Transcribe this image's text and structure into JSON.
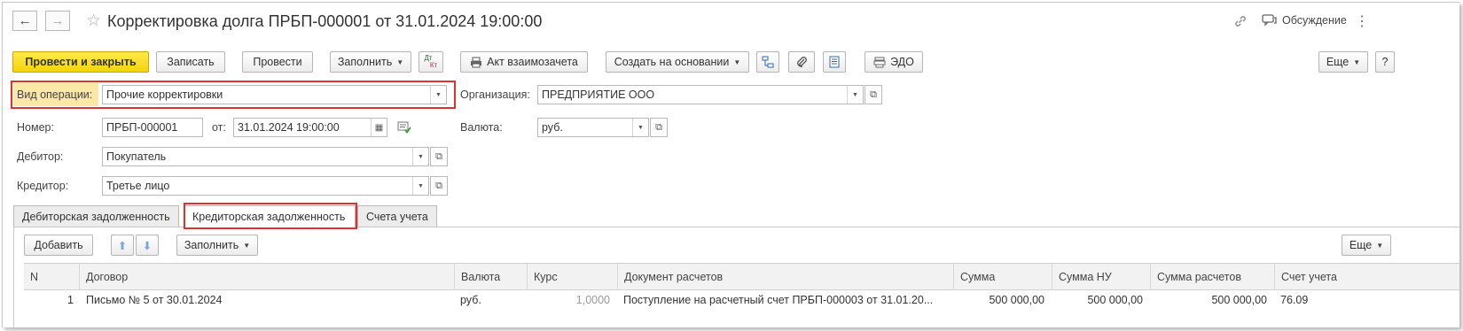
{
  "window": {
    "title": "Корректировка долга ПРБП-000001 от 31.01.2024 19:00:00",
    "discussion": "Обсуждение"
  },
  "toolbar": {
    "post_close": "Провести и закрыть",
    "save": "Записать",
    "post": "Провести",
    "fill": "Заполнить",
    "dtkt_top": "Дт",
    "dtkt_bottom": "Кт",
    "offset_act": "Акт взаимозачета",
    "create_based": "Создать на основании",
    "edo": "ЭДО",
    "more": "Еще",
    "help": "?"
  },
  "form": {
    "operation_label": "Вид операции:",
    "operation_value": "Прочие корректировки",
    "org_label": "Организация:",
    "org_value": "ПРЕДПРИЯТИЕ ООО",
    "number_label": "Номер:",
    "number_value": "ПРБП-000001",
    "from_label": "от:",
    "date_value": "31.01.2024 19:00:00",
    "currency_label": "Валюта:",
    "currency_value": "руб.",
    "debtor_label": "Дебитор:",
    "debtor_value": "Покупатель",
    "creditor_label": "Кредитор:",
    "creditor_value": "Третье лицо"
  },
  "tabs": [
    {
      "label": "Дебиторская задолженность"
    },
    {
      "label": "Кредиторская задолженность"
    },
    {
      "label": "Счета учета"
    }
  ],
  "table_toolbar": {
    "add": "Добавить",
    "fill": "Заполнить",
    "more": "Еще"
  },
  "table": {
    "columns": [
      "N",
      "Договор",
      "Валюта",
      "Курс",
      "Документ расчетов",
      "Сумма",
      "Сумма НУ",
      "Сумма расчетов",
      "Счет учета"
    ],
    "rows": [
      {
        "n": "1",
        "contract": "Письмо № 5 от 30.01.2024",
        "currency": "руб.",
        "rate": "1,0000",
        "document": "Поступление на расчетный счет ПРБП-000003 от 31.01.20...",
        "sum": "500 000,00",
        "sum_nu": "500 000,00",
        "sum_calc": "500 000,00",
        "account": "76.09"
      }
    ]
  },
  "colors": {
    "primary": "#f5d40a",
    "highlight": "#e03030",
    "label_highlight_bg": "#fbe7a6"
  }
}
